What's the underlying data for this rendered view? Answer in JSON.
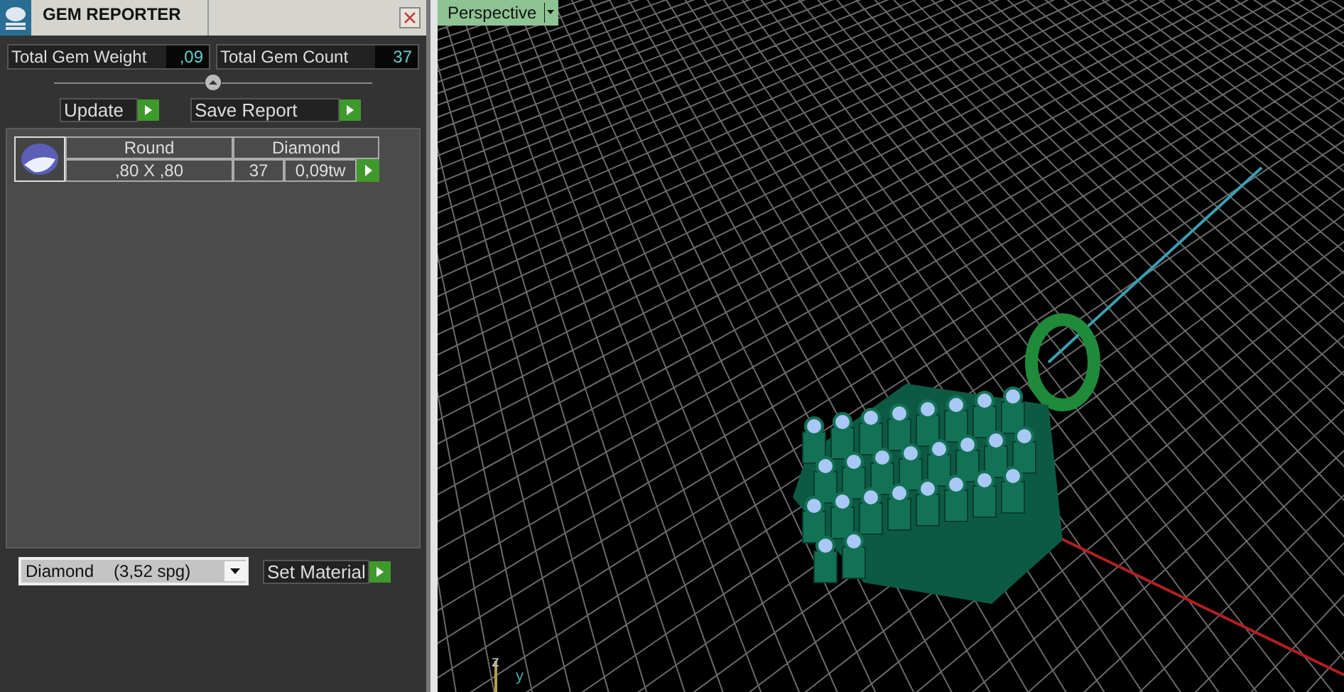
{
  "panel": {
    "title": "GEM REPORTER",
    "stats": [
      {
        "label": "Total Gem Weight",
        "value": ",09"
      },
      {
        "label": "Total Gem Count",
        "value": "37"
      }
    ],
    "buttons": [
      {
        "label": "Update"
      },
      {
        "label": "Save Report"
      }
    ],
    "gems": [
      {
        "shape": "Round",
        "material": "Diamond",
        "size": ",80 X ,80",
        "count": "37",
        "weight": "0,09tw"
      }
    ],
    "material_select": {
      "material": "Diamond",
      "density": "(3,52 spg)"
    },
    "set_button": "Set Material"
  },
  "viewport": {
    "view_menu": "Perspective",
    "axis_labels": [
      "z",
      "y"
    ]
  }
}
